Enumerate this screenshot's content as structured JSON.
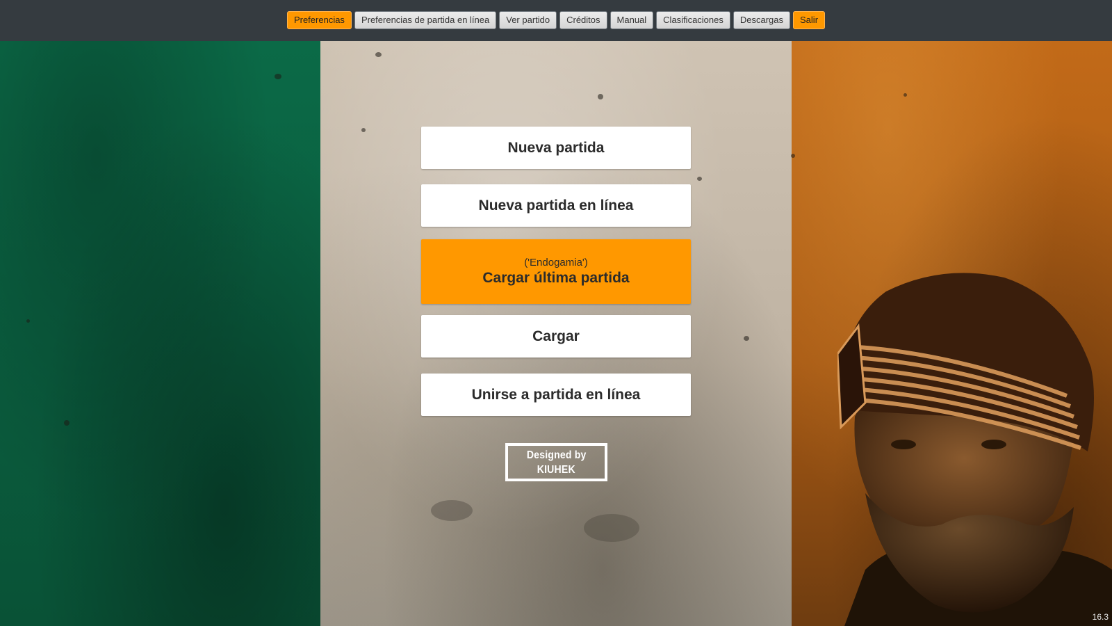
{
  "nav": {
    "items": [
      {
        "label": "Preferencias",
        "accent": true
      },
      {
        "label": "Preferencias de partida en línea",
        "accent": false
      },
      {
        "label": "Ver partido",
        "accent": false
      },
      {
        "label": "Créditos",
        "accent": false
      },
      {
        "label": "Manual",
        "accent": false
      },
      {
        "label": "Clasificaciones",
        "accent": false
      },
      {
        "label": "Descargas",
        "accent": false
      },
      {
        "label": "Salir",
        "accent": true
      }
    ]
  },
  "menu": {
    "new_game": "Nueva partida",
    "new_online_game": "Nueva partida en línea",
    "load_last": {
      "subtitle": "('Endogamia')",
      "label": "Cargar última partida"
    },
    "load": "Cargar",
    "join_online": "Unirse a partida en línea"
  },
  "badge": {
    "line1": "Designed by",
    "line2": "KIUHEK"
  },
  "version": "16.3",
  "colors": {
    "accent": "#ff9800",
    "topbar": "#353b40",
    "flag_green": "#0b6a47",
    "flag_white": "#cfc3b3",
    "flag_orange": "#c26a18"
  }
}
